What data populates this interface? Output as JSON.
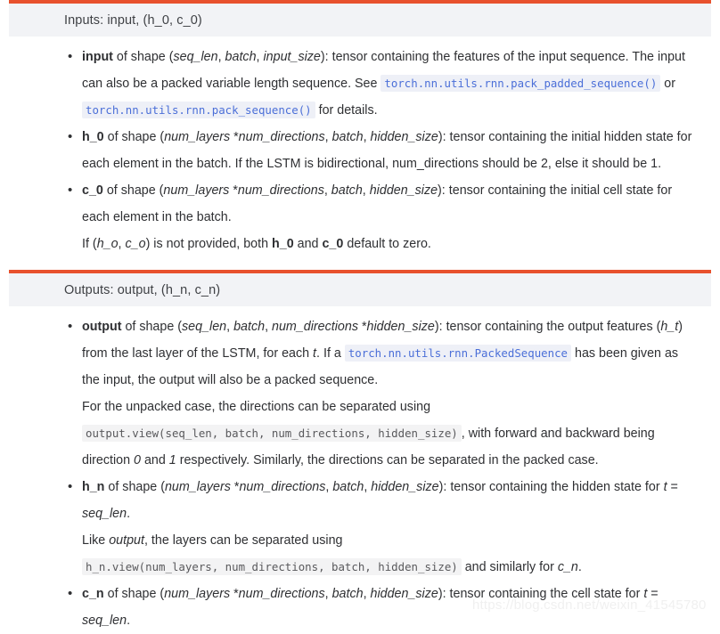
{
  "theme": {
    "accent_orange": "#e8512d",
    "header_bg": "#f2f3f6",
    "code_link_color": "#4b6fd8",
    "code_link_bg": "#eef0f7",
    "code_literal_color": "#59595c",
    "code_literal_bg": "#f3f3f4",
    "text_color": "#2f3033",
    "page_bg": "#ffffff"
  },
  "inputs_section": {
    "header": "Inputs: input, (h_0, c_0)",
    "items": [
      {
        "name": "input",
        "shape_open": " of shape (",
        "shape_parts": [
          "seq_len",
          "batch",
          "input_size"
        ],
        "shape_close": "): ",
        "text_1": "tensor containing the features of the input sequence. The input can also be a packed variable length sequence. See ",
        "code_1": "torch.nn.utils.rnn.pack_padded_sequence()",
        "text_2": " or ",
        "code_2": "torch.nn.utils.rnn.pack_sequence()",
        "text_3": " for details."
      },
      {
        "name": "h_0",
        "shape_open": " of shape (",
        "shape_parts": [
          "num_layers",
          "*",
          "num_directions",
          "batch",
          "hidden_size"
        ],
        "shape_close": "): ",
        "text_1": "tensor containing the initial hidden state for each element in the batch. If the LSTM is bidirectional, num_directions should be 2, else it should be 1."
      },
      {
        "name": "c_0",
        "shape_open": " of shape (",
        "shape_parts": [
          "num_layers",
          "*",
          "num_directions",
          "batch",
          "hidden_size"
        ],
        "shape_close": "): ",
        "text_1": "tensor containing the initial cell state for each element in the batch."
      }
    ],
    "default_note": {
      "lead": "If (",
      "var_a": "h_o",
      "mid_1": ", ",
      "var_b": "c_o",
      "mid_2": ") is not provided, both ",
      "bold_a": "h_0",
      "mid_3": " and ",
      "bold_b": "c_0",
      "tail": " default to zero."
    }
  },
  "outputs_section": {
    "header": "Outputs: output, (h_n, c_n)",
    "items": [
      {
        "name": "output",
        "shape_open": " of shape (",
        "shape_parts": [
          "seq_len",
          "batch",
          "num_directions",
          "*",
          "hidden_size"
        ],
        "shape_close": "): ",
        "text_1": "tensor containing the output features (",
        "italic_1": "h_t",
        "text_2": ") from the last layer of the LSTM, for each ",
        "italic_2": "t",
        "text_3": ". If a ",
        "code_1": "torch.nn.utils.rnn.PackedSequence",
        "text_4": " has been given as the input, the output will also be a packed sequence."
      },
      {
        "name": "h_n",
        "shape_open": " of shape (",
        "shape_parts": [
          "num_layers",
          "*",
          "num_directions",
          "batch",
          "hidden_size"
        ],
        "shape_close": "): ",
        "text_1": "tensor containing the hidden state for ",
        "italic_1": "t",
        "text_2": " = ",
        "italic_2": "seq_len",
        "text_3": "."
      },
      {
        "name": "c_n",
        "shape_open": " of shape (",
        "shape_parts": [
          "num_layers",
          "*",
          "num_directions",
          "batch",
          "hidden_size"
        ],
        "shape_close": "): ",
        "text_1": "tensor containing the cell state for ",
        "italic_1": "t",
        "text_2": " = ",
        "italic_2": "seq_len",
        "text_3": "."
      }
    ],
    "unpacked_note": {
      "text_1": "For the unpacked case, the directions can be separated using ",
      "code_1": "output.view(seq_len, batch, num_directions, hidden_size)",
      "text_2": ", with forward and backward being direction ",
      "italic_1": "0",
      "text_3": " and ",
      "italic_2": "1",
      "text_4": " respectively. Similarly, the directions can be separated in the packed case."
    },
    "layers_note": {
      "text_1": "Like ",
      "italic_1": "output",
      "text_2": ", the layers can be separated using ",
      "code_1": "h_n.view(num_layers, num_directions, batch, hidden_size)",
      "text_3": " and similarly for ",
      "italic_2": "c_n",
      "text_4": "."
    }
  },
  "watermark": {
    "text": "https://blog.csdn.net/weixin_41545780"
  }
}
